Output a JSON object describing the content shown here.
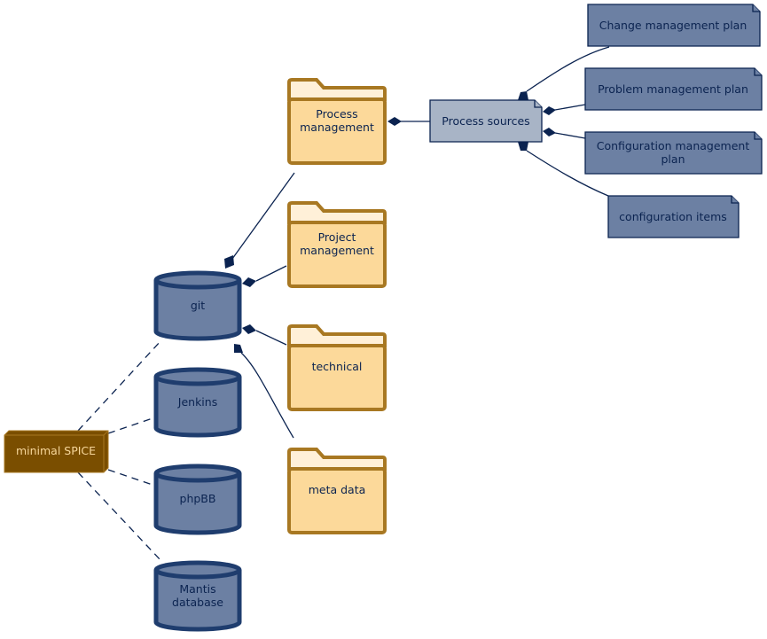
{
  "nodes": {
    "minimal_spice": "minimal SPICE",
    "git": "git",
    "jenkins": "Jenkins",
    "phpbb": "phpBB",
    "mantis": [
      "Mantis",
      "database"
    ],
    "process_management": [
      "Process",
      "management"
    ],
    "project_management": [
      "Project",
      "management"
    ],
    "technical": "technical",
    "meta_data": "meta data",
    "process_sources": "Process sources",
    "change_plan": "Change management plan",
    "problem_plan": "Problem management plan",
    "config_plan": [
      "Configuration management",
      "plan"
    ],
    "config_items": "configuration items"
  },
  "colors": {
    "folder": "#fcd99a",
    "folder_border": "#a87822",
    "database": "#6c80a3",
    "node": "#7a4e00",
    "note": "#6c80a3",
    "note_light": "#a8b4c6",
    "edge": "#0b2350"
  }
}
